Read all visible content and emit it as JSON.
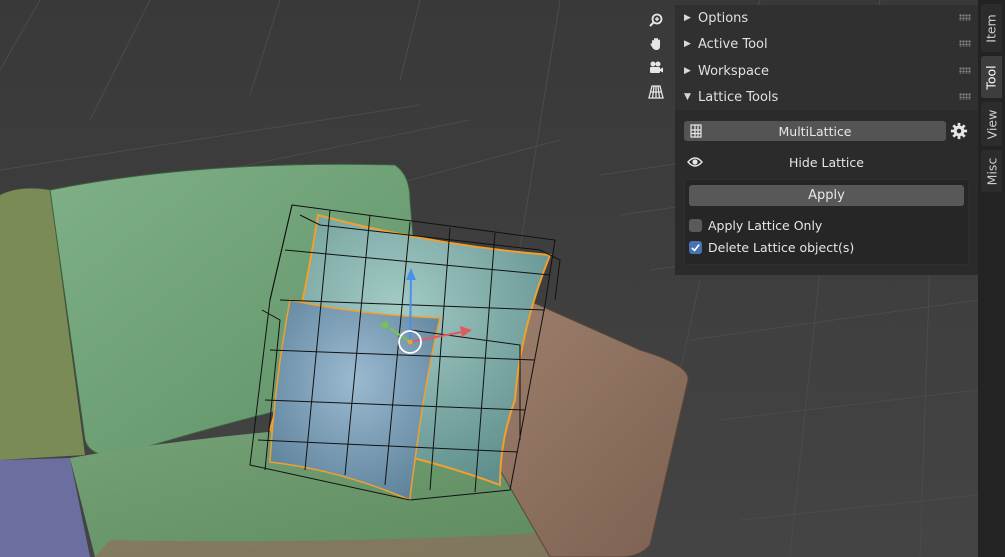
{
  "viewport": {
    "nav_buttons": [
      {
        "icon": "zoom-icon"
      },
      {
        "icon": "hand-pan-icon"
      },
      {
        "icon": "camera-icon"
      },
      {
        "icon": "grid-perspective-icon"
      }
    ]
  },
  "sidebar": {
    "panels": [
      {
        "label": "Options",
        "expanded": false
      },
      {
        "label": "Active Tool",
        "expanded": false
      },
      {
        "label": "Workspace",
        "expanded": false
      },
      {
        "label": "Lattice Tools",
        "expanded": true
      }
    ],
    "lattice_tools": {
      "multilattice_label": "MultiLattice",
      "hide_label": "Hide Lattice",
      "apply_label": "Apply",
      "apply_lattice_only": {
        "label": "Apply Lattice Only",
        "checked": false
      },
      "delete_lattice_objects": {
        "label": "Delete Lattice object(s)",
        "checked": true
      }
    },
    "tabs": [
      {
        "label": "Item",
        "active": false
      },
      {
        "label": "Tool",
        "active": true
      },
      {
        "label": "View",
        "active": false
      },
      {
        "label": "Misc",
        "active": false
      }
    ]
  },
  "colors": {
    "checkbox_accent": "#4772b3",
    "selection_outline": "#f0a030",
    "sofa_green": "#6a9a6e",
    "pillow_blue": "#7fa9b6"
  }
}
